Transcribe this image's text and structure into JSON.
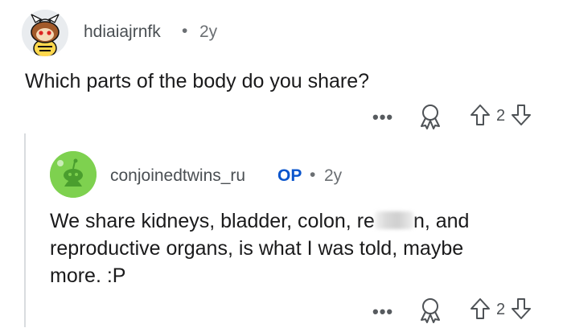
{
  "comment1": {
    "username": "hdiaiajrnfk",
    "separator": "•",
    "time": "2y",
    "text": "Which parts of the body do you share?",
    "more": "•••",
    "vote_count": "2"
  },
  "comment2": {
    "username": "conjoinedtwins_ru",
    "op_badge": "OP",
    "separator": "•",
    "time": "2y",
    "text_line1_a": "We share kidneys, bladder, colon, re",
    "text_line1_b": "n, and",
    "text_line2": "reproductive organs, is what I was told, maybe",
    "text_line3": "more. :P",
    "more": "•••",
    "vote_count": "2"
  },
  "colors": {
    "op_blue": "#0a55cc",
    "reply_avatar_green": "#7ed14f"
  }
}
